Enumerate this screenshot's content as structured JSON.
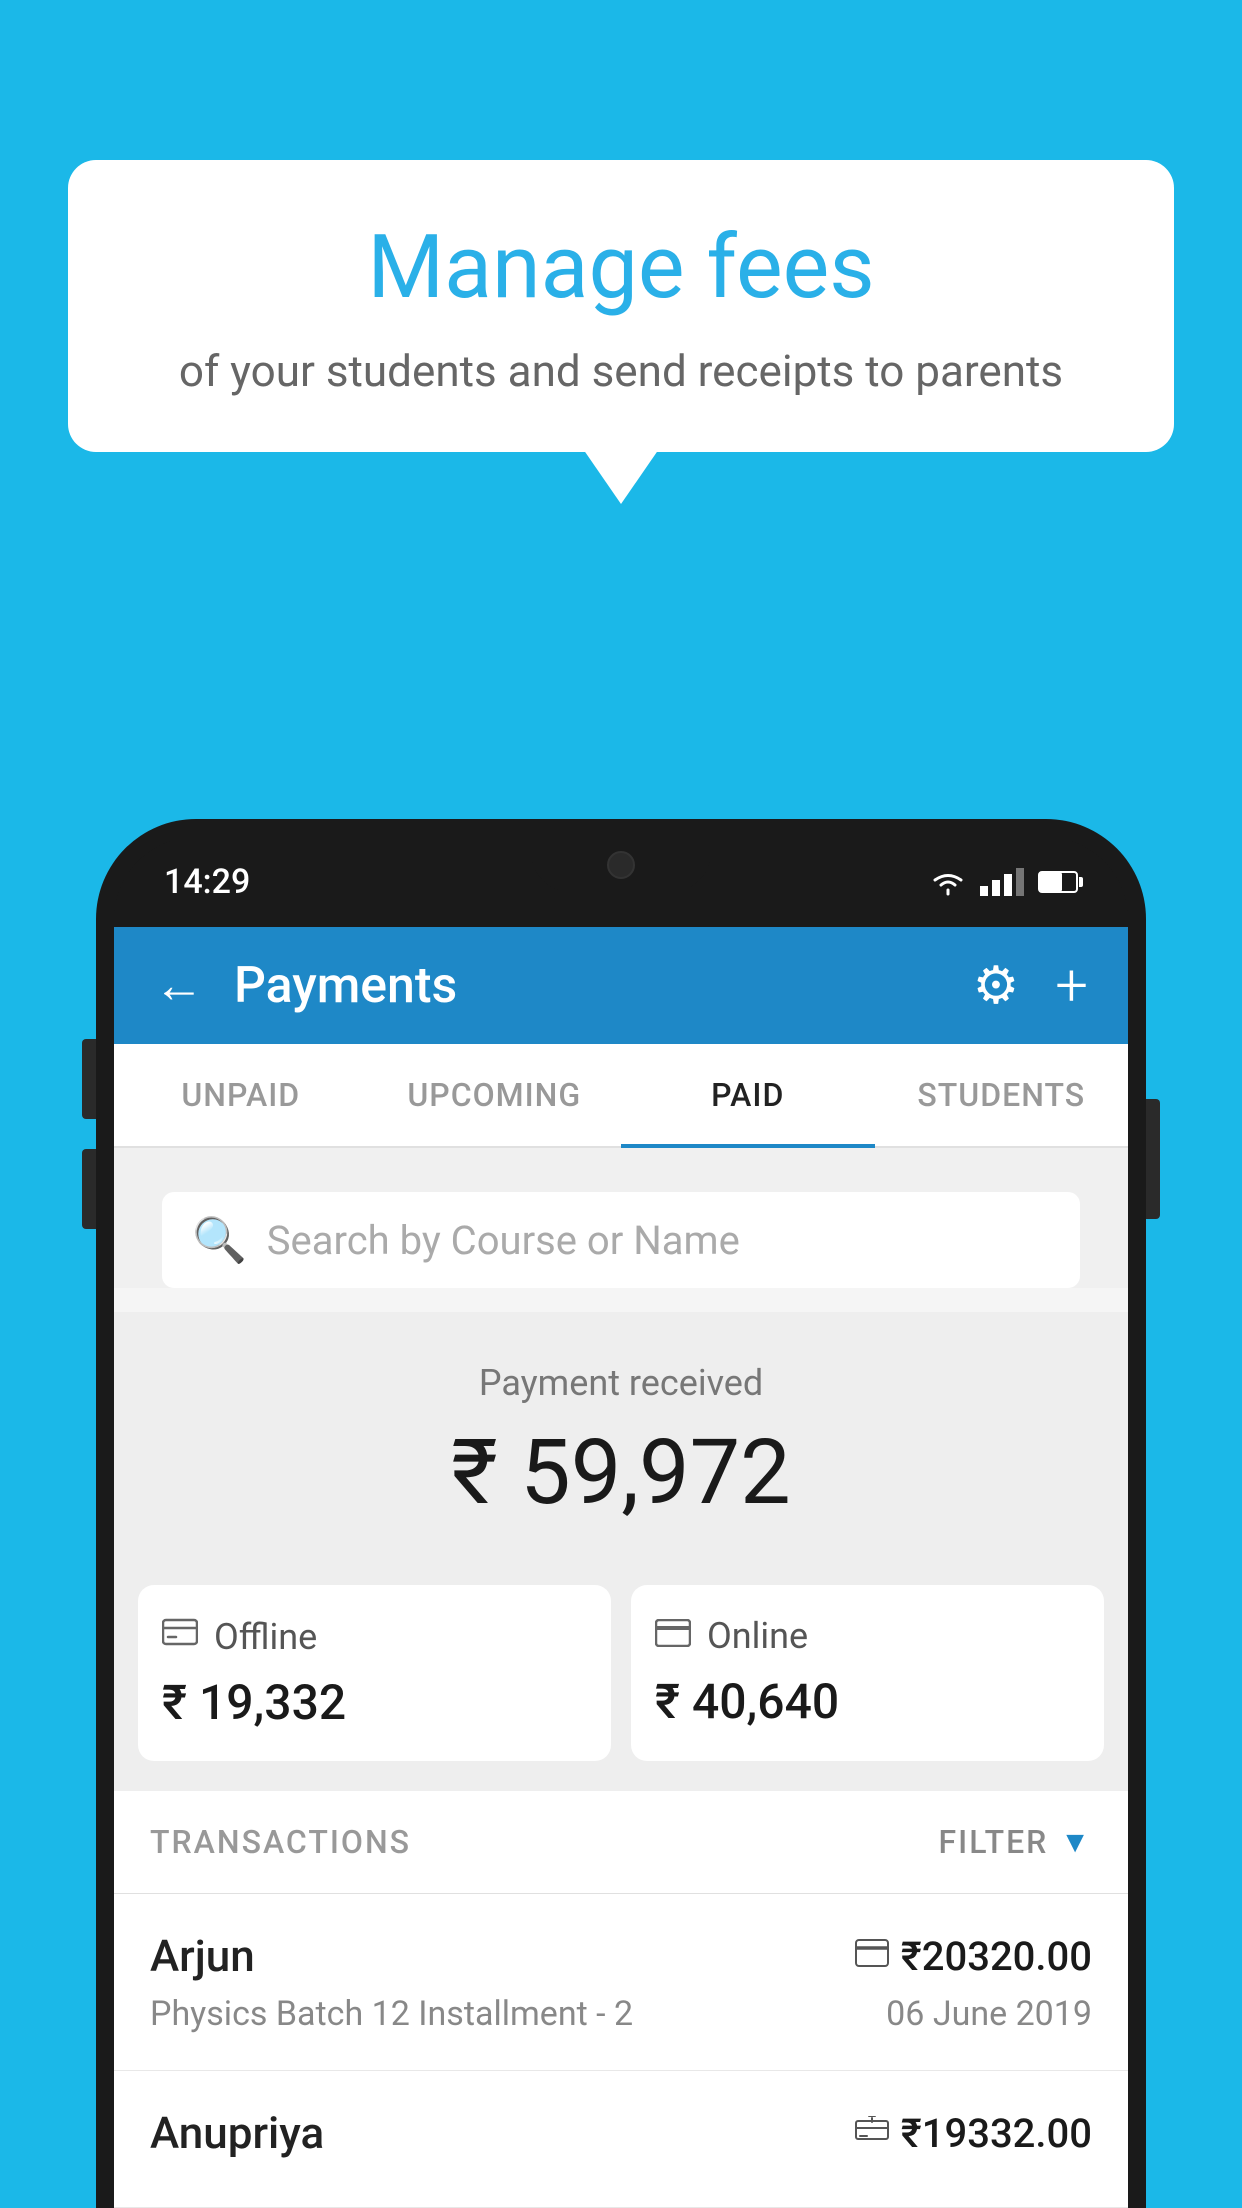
{
  "background": {
    "color": "#1bb8e8"
  },
  "speech_bubble": {
    "title": "Manage fees",
    "subtitle": "of your students and send receipts to parents"
  },
  "phone": {
    "status_bar": {
      "time": "14:29"
    },
    "app_header": {
      "title": "Payments",
      "back_label": "←",
      "gear_label": "⚙",
      "plus_label": "+"
    },
    "tabs": [
      {
        "label": "UNPAID",
        "active": false
      },
      {
        "label": "UPCOMING",
        "active": false
      },
      {
        "label": "PAID",
        "active": true
      },
      {
        "label": "STUDENTS",
        "active": false
      }
    ],
    "search": {
      "placeholder": "Search by Course or Name"
    },
    "payment_received": {
      "label": "Payment received",
      "amount": "₹ 59,972",
      "offline": {
        "icon": "💳",
        "mode": "Offline",
        "amount": "₹ 19,332"
      },
      "online": {
        "icon": "💳",
        "mode": "Online",
        "amount": "₹ 40,640"
      }
    },
    "transactions": {
      "header_label": "TRANSACTIONS",
      "filter_label": "FILTER",
      "items": [
        {
          "name": "Arjun",
          "course": "Physics Batch 12 Installment - 2",
          "amount": "₹20320.00",
          "date": "06 June 2019",
          "payment_type": "online"
        },
        {
          "name": "Anupriya",
          "course": "",
          "amount": "₹19332.00",
          "date": "",
          "payment_type": "offline"
        }
      ]
    }
  }
}
